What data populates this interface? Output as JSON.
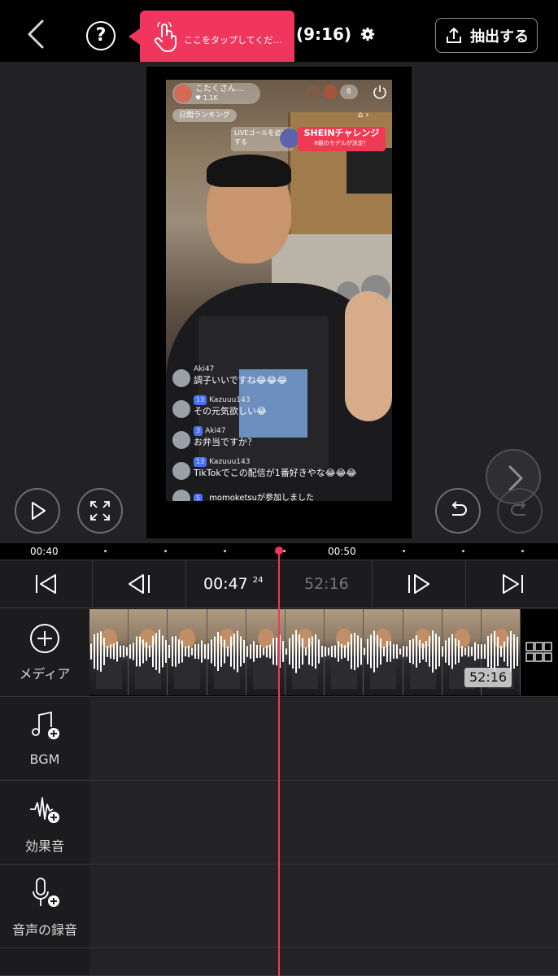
{
  "header": {
    "help_label": "?",
    "tooltip_text": "ここをタップしてくだ…",
    "aspect_ratio": "(9:16)",
    "export_label": "抽出する"
  },
  "video_overlay": {
    "streamer_name": "こたくさん…",
    "streamer_likes": "♥ 1.1K",
    "viewer_count": "8",
    "ranking_label": "日間ランキング",
    "live_goal_text": "LIVEゴールを追加する",
    "shein_title": "SHEINチャレンジ",
    "shein_sub": "8組のモデルが決定！",
    "comments": [
      {
        "level": "",
        "user": "Aki47",
        "message": "調子いいですね😂😂😂"
      },
      {
        "level": "13",
        "user": "Kazuuu143",
        "message": "その元気欲しい😂"
      },
      {
        "level": "3",
        "user": "Aki47",
        "message": "お弁当ですか？"
      },
      {
        "level": "13",
        "user": "Kazuuu143",
        "message": "TikTokでこの配信が1番好きやな😂😂😂"
      }
    ],
    "join_level": "5",
    "join_message": "momoketsuが参加しました"
  },
  "timeline": {
    "ruler_labels": [
      "00:40",
      "00:50"
    ],
    "current_time": "00:47",
    "current_frame": "24",
    "total_time": "52:16",
    "clip_duration": "52:16"
  },
  "tracks": {
    "media_label": "メディア",
    "bgm_label": "BGM",
    "sfx_label": "効果音",
    "voice_label": "音声の録音"
  },
  "colors": {
    "accent": "#f0365c",
    "background": "#1c1c1e",
    "topbar": "#000000"
  }
}
